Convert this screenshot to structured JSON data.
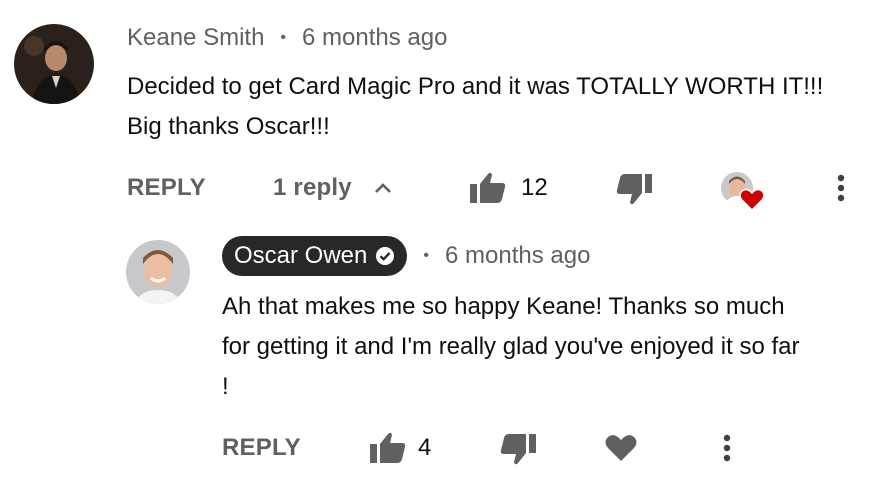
{
  "comment": {
    "author": "Keane Smith",
    "separator": "•",
    "time": "6 months ago",
    "text_line1": "Decided to get Card Magic Pro and it was TOTALLY WORTH IT!!!",
    "text_line2": "Big thanks Oscar!!!",
    "reply_label": "REPLY",
    "replies_label": "1 reply",
    "like_count": "12"
  },
  "reply": {
    "author": "Oscar Owen",
    "separator": "•",
    "time": "6 months ago",
    "text_line1": "Ah that makes me so happy Keane! Thanks so much",
    "text_line2": "for getting it and I'm really glad you've enjoyed it so far",
    "text_line3": "!",
    "reply_label": "REPLY",
    "like_count": "4"
  },
  "colors": {
    "secondary_text": "#606060",
    "heart": "#cc0000",
    "owner_badge": "#282828"
  },
  "icons": [
    "thumb-up-icon",
    "thumb-down-icon",
    "chevron-up-icon",
    "heart-icon",
    "more-vert-icon",
    "verified-check-icon"
  ]
}
